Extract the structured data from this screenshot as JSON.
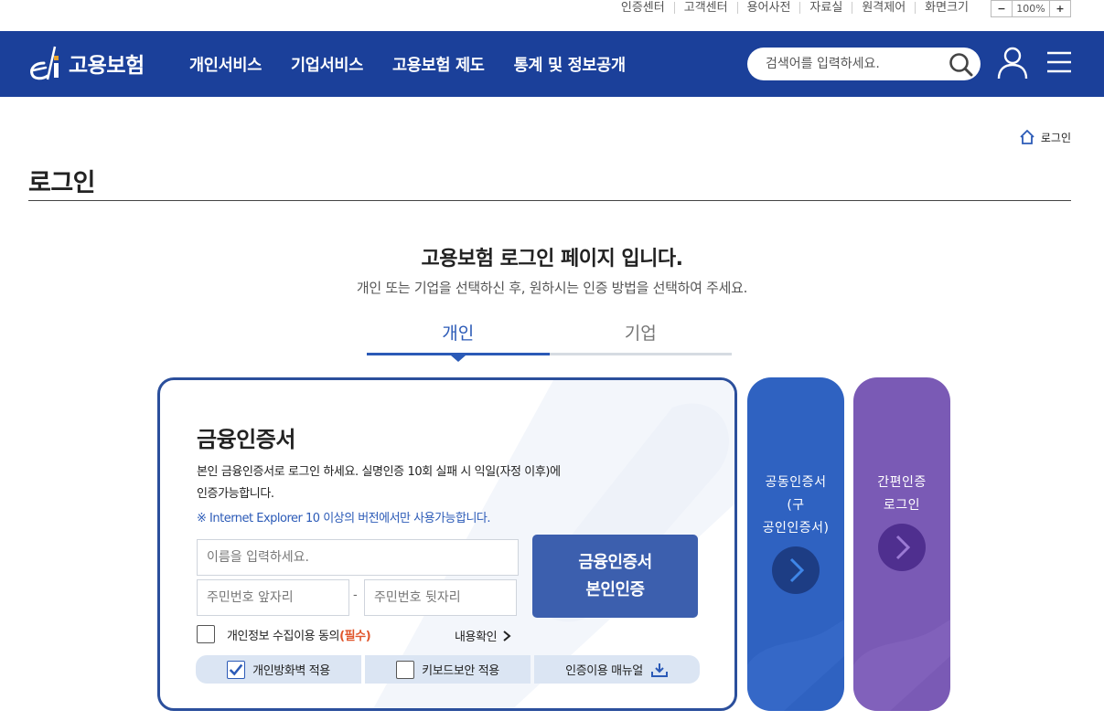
{
  "util": {
    "links": [
      "인증센터",
      "고객센터",
      "용어사전",
      "자료실",
      "원격제어",
      "화면크기"
    ],
    "zoom_minus": "−",
    "zoom_value": "100%",
    "zoom_plus": "+"
  },
  "header": {
    "logo_text": "고용보험",
    "nav": [
      "개인서비스",
      "기업서비스",
      "고용보험 제도",
      "통계 및 정보공개"
    ],
    "search_placeholder": "검색어를 입력하세요."
  },
  "breadcrumb": {
    "current": "로그인"
  },
  "page_title": "로그인",
  "main": {
    "heading": "고용보험 로그인 페이지 입니다.",
    "subheading": "개인 또는 기업을 선택하신 후, 원하시는 인증 방법을 선택하여 주세요."
  },
  "tabs": [
    {
      "label": "개인",
      "active": true
    },
    {
      "label": "기업",
      "active": false
    }
  ],
  "card": {
    "title": "금융인증서",
    "desc_line1": "본인 금융인증서로 로그인 하세요. 실명인증 10회 실패 시 익일(자정 이후)에",
    "desc_line2": "인증가능합니다.",
    "note": "※ Internet Explorer 10 이상의 버전에서만 사용가능합니다.",
    "name_placeholder": "이름을 입력하세요.",
    "rrn_front_placeholder": "주민번호 앞자리",
    "rrn_back_placeholder": "주민번호 뒷자리",
    "dash": "-",
    "cert_button_line1": "금융인증서",
    "cert_button_line2": "본인인증",
    "agree_label": "개인정보 수집이용 동의",
    "agree_required": "(필수)",
    "view_link": "내용확인",
    "options": [
      "개인방화벽 적용",
      "키보드보안 적용",
      "인증이용 매뉴얼"
    ],
    "firewall_checked": true,
    "keyboard_checked": false
  },
  "side_cards": {
    "joint_cert_line1": "공동인증서",
    "joint_cert_line2": "(구",
    "joint_cert_line3": "공인인증서)",
    "simple_cert_line1": "간편인증",
    "simple_cert_line2": "로그인"
  },
  "colors": {
    "header_bg": "#1b409a",
    "accent": "#2b5ab7",
    "required": "#e0552b",
    "side_blue": "#2f62c1",
    "side_purple": "#7a5ab5"
  }
}
